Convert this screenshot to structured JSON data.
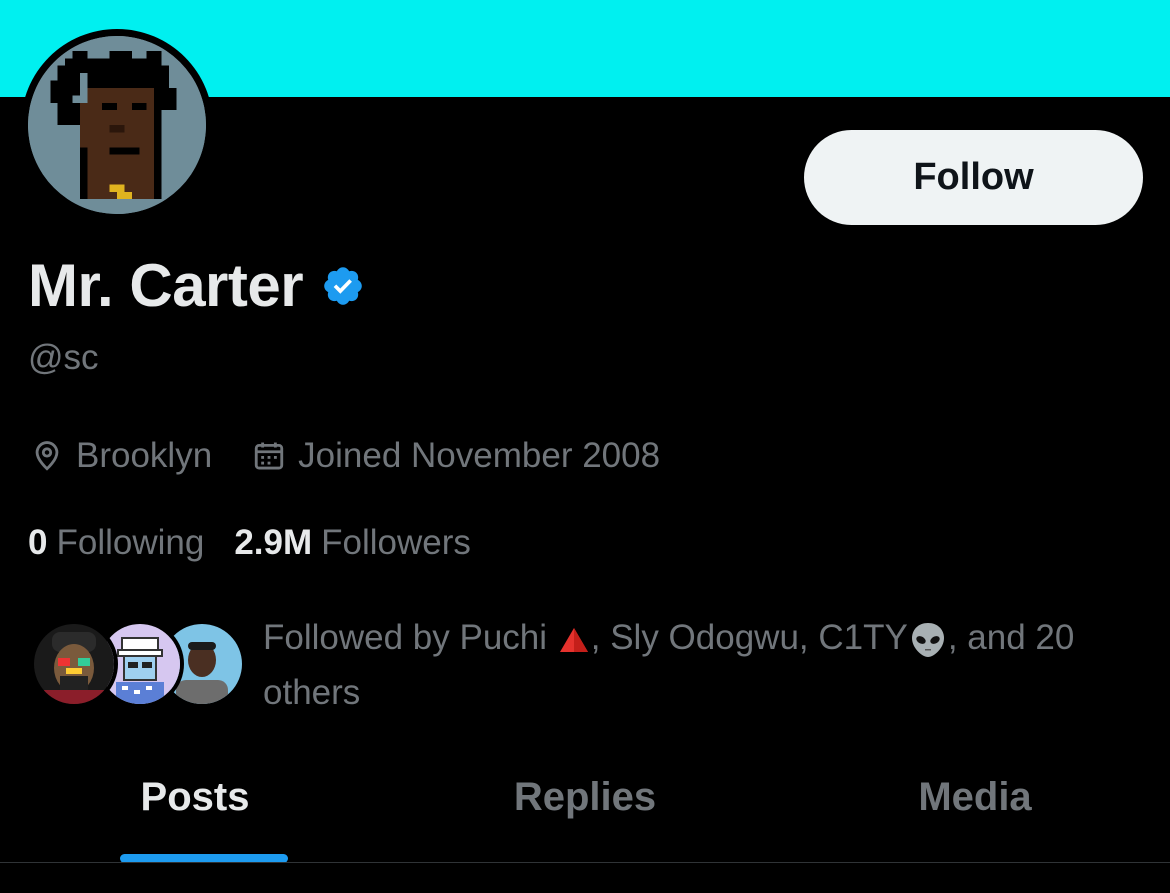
{
  "colors": {
    "banner": "#00f0f0",
    "background": "#000000",
    "accent": "#1d9bf0",
    "muted_text": "#71767b"
  },
  "profile": {
    "display_name": "Mr. Carter",
    "handle": "@sc",
    "location": "Brooklyn",
    "joined": "Joined November 2008",
    "follow_button_label": "Follow",
    "verified_icon": "verified-badge-icon"
  },
  "stats": {
    "following_count": "0",
    "following_label": "Following",
    "followers_count": "2.9M",
    "followers_label": "Followers"
  },
  "followed_by": {
    "prefix": "Followed by Puchi ",
    "name2": ", Sly Odogwu, C1TY",
    "suffix": ", and 20 others",
    "emoji_after_name1": "red-triangle-icon",
    "emoji_after_name3": "alien-icon"
  },
  "tabs": [
    {
      "label": "Posts",
      "active": true
    },
    {
      "label": "Replies",
      "active": false
    },
    {
      "label": "Media",
      "active": false
    }
  ]
}
